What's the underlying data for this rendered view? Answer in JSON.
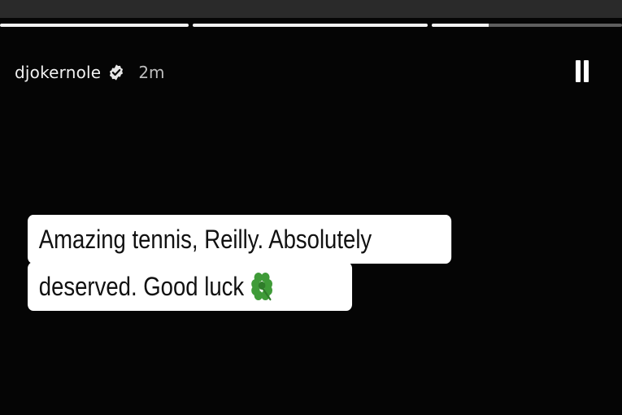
{
  "story": {
    "progress": [
      {
        "fill": 1.0
      },
      {
        "fill": 1.0
      },
      {
        "fill": 0.3
      }
    ],
    "username": "djokernole",
    "verified_icon": "verified-badge-icon",
    "time": "2m",
    "pause_icon": "pause-icon",
    "caption": {
      "line1": "Amazing tennis, Reilly. Absolutely",
      "line2": "deserved. Good luck",
      "emoji_icon": "four-leaf-clover-icon"
    }
  },
  "colors": {
    "background": "#050505",
    "text": "#f2f2f2",
    "caption_bg": "#ffffff",
    "clover": "#3f9b38"
  }
}
